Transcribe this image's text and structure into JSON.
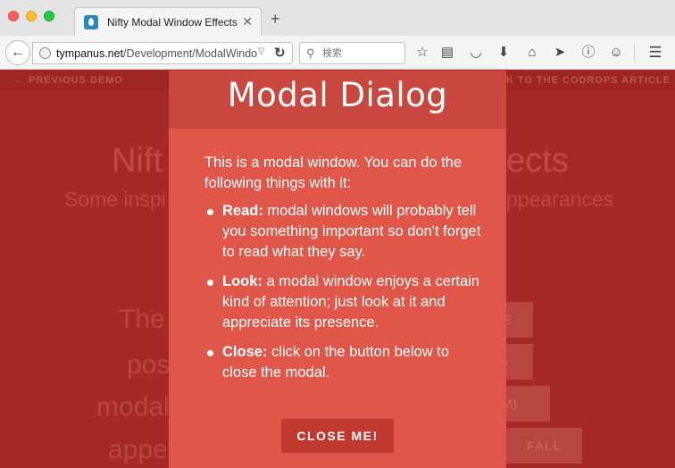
{
  "browser": {
    "tab_title": "Nifty Modal Window Effects",
    "tab_close": "✕",
    "new_tab": "+",
    "url_host": "tympanus.net",
    "url_path": "/Development/ModalWindo",
    "search_placeholder": "検索"
  },
  "page": {
    "prev_demo": "← PREVIOUS DEMO",
    "back_article": "BACK TO THE CODROPS ARTICLE",
    "title_left": "Nift",
    "title_right": "ects",
    "subtitle_left": "Some inspi",
    "subtitle_right": "ppearances",
    "lines": [
      "The",
      "pos",
      "modal",
      "appe"
    ],
    "buttons": [
      "E",
      ")",
      "OM)",
      "FALL"
    ]
  },
  "modal": {
    "title": "Modal Dialog",
    "intro": "This is a modal window. You can do the following things with it:",
    "items": [
      {
        "label": "Read:",
        "text": " modal windows will probably tell you something important so don't forget to read what they say."
      },
      {
        "label": "Look:",
        "text": " a modal window enjoys a certain kind of attention; just look at it and appreciate its presence."
      },
      {
        "label": "Close:",
        "text": " click on the button below to close the modal."
      }
    ],
    "close_label": "CLOSE ME!"
  }
}
